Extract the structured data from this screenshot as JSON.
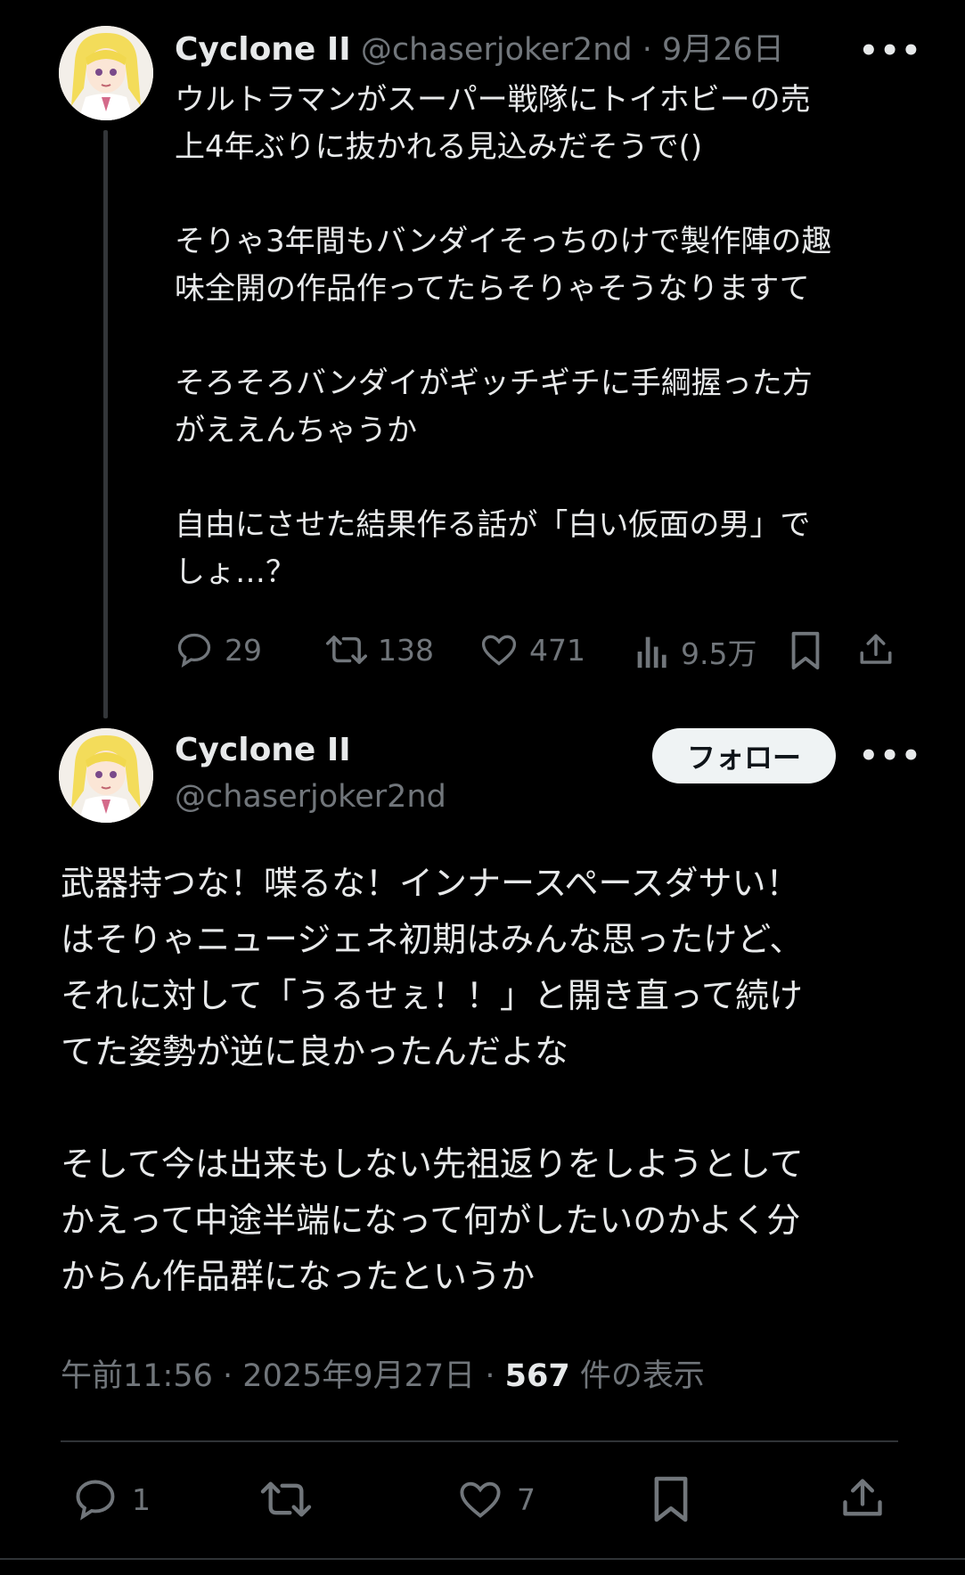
{
  "parent_tweet": {
    "display_name": "Cyclone II",
    "handle": "@chaserjoker2nd",
    "date": "9月26日",
    "body": "ウルトラマンがスーパー戦隊にトイホビーの売\n上4年ぶりに抜かれる見込みだそうで()\n\nそりゃ3年間もバンダイそっちのけで製作陣の趣\n味全開の作品作ってたらそりゃそうなりますて\n\nそろそろバンダイがギッチギチに手綱握った方\nがええんちゃうか\n\n自由にさせた結果作る話が「白い仮面の男」で\nしょ…？",
    "actions": {
      "reply_count": "29",
      "retweet_count": "138",
      "like_count": "471",
      "view_count": "9.5万"
    }
  },
  "main_tweet": {
    "display_name": "Cyclone II",
    "handle": "@chaserjoker2nd",
    "follow_label": "フォロー",
    "body": "武器持つな！喋るな！インナースペースダサい！\nはそりゃニュージェネ初期はみんな思ったけど、\nそれに対して「うるせぇ！！」と開き直って続け\nてた姿勢が逆に良かったんだよな\n\nそして今は出来もしない先祖返りをしようとして\nかえって中途半端になって何がしたいのかよく分\nからん作品群になったというか",
    "time": "午前11:56",
    "date": "2025年9月27日",
    "views": "567",
    "views_suffix": "件の表示",
    "actions": {
      "reply_count": "1",
      "like_count": "7"
    }
  },
  "separator": "·",
  "colors": {
    "background": "#000000",
    "text": "#e7e9ea",
    "muted": "#71767b",
    "divider": "#2f3336",
    "follow_bg": "#eff3f4"
  },
  "icons": [
    "reply-icon",
    "retweet-icon",
    "like-icon",
    "views-icon",
    "bookmark-icon",
    "share-icon",
    "more-icon"
  ]
}
